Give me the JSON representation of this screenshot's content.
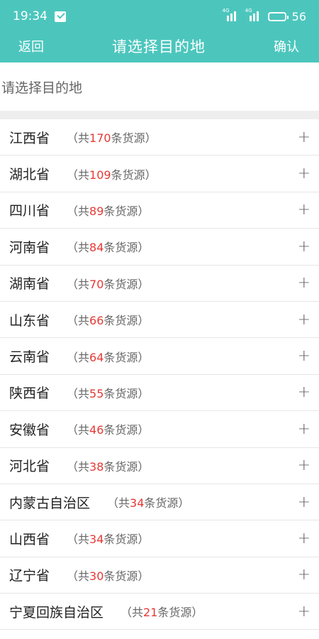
{
  "status_bar": {
    "time": "19:34",
    "signal1_tag": "4G",
    "signal2_tag": "4G",
    "battery": "56"
  },
  "nav": {
    "back_label": "返回",
    "title": "请选择目的地",
    "confirm_label": "确认"
  },
  "destination": {
    "placeholder": "请选择目的地"
  },
  "count_prefix": "（共",
  "count_suffix": "条货源）",
  "provinces": [
    {
      "name": "江西省",
      "count": "170"
    },
    {
      "name": "湖北省",
      "count": "109"
    },
    {
      "name": "四川省",
      "count": "89"
    },
    {
      "name": "河南省",
      "count": "84"
    },
    {
      "name": "湖南省",
      "count": "70"
    },
    {
      "name": "山东省",
      "count": "66"
    },
    {
      "name": "云南省",
      "count": "64"
    },
    {
      "name": "陕西省",
      "count": "55"
    },
    {
      "name": "安徽省",
      "count": "46"
    },
    {
      "name": "河北省",
      "count": "38"
    },
    {
      "name": "内蒙古自治区",
      "count": "34"
    },
    {
      "name": "山西省",
      "count": "34"
    },
    {
      "name": "辽宁省",
      "count": "30"
    },
    {
      "name": "宁夏回族自治区",
      "count": "21"
    }
  ],
  "expand_symbol": "+",
  "colors": {
    "header": "#4cc6bd",
    "count_highlight": "#e53935"
  },
  "icons": {
    "message": "message-icon",
    "signal": "signal-icon",
    "battery": "battery-icon",
    "expand": "plus-icon"
  }
}
